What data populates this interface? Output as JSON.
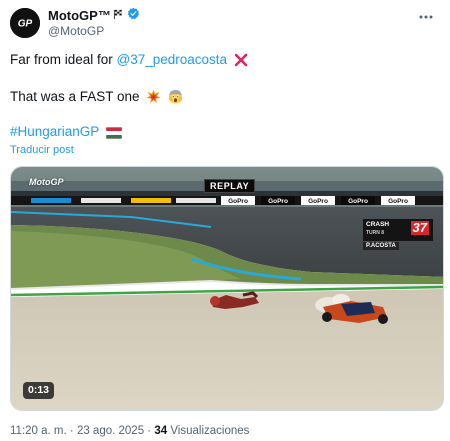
{
  "author": {
    "display_name": "MotoGP™",
    "handle": "@MotoGP",
    "avatar_text": "GP",
    "badges": [
      "checkered-flag-icon",
      "verified-icon"
    ]
  },
  "tweet": {
    "line1_prefix": "Far from ideal for ",
    "line1_mention": "@37_pedroacosta",
    "line1_emoji": "cross-mark-icon",
    "line2_text": "That was a FAST one",
    "line2_emojis": [
      "collision-icon",
      "scream-face-icon"
    ],
    "line3_hashtag": "#HungarianGP",
    "line3_emoji": "hungary-flag-icon"
  },
  "translate_label": "Traducir post",
  "media": {
    "duration": "0:13",
    "overlay_replay": "REPLAY",
    "overlay_logo": "MotoGP",
    "crash_label_line1": "CRASH",
    "crash_label_line2": "TURN 8",
    "crash_number": "37",
    "crash_rider": "P.ACOSTA",
    "banner_text": "GoPro"
  },
  "footer": {
    "time": "11:20 a. m.",
    "date": "23 ago. 2025",
    "separator": "·",
    "views_count": "34",
    "views_label": "Visualizaciones"
  },
  "colors": {
    "link": "#1d9bf0",
    "text": "#0f1419",
    "muted": "#536471",
    "verified": "#1d9bf0"
  }
}
